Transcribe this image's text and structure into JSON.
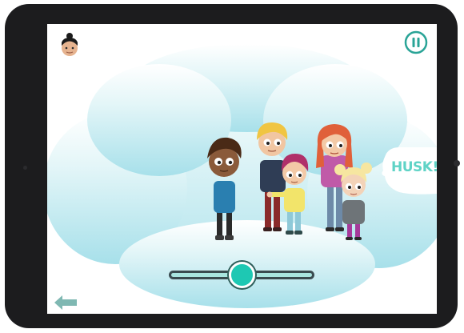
{
  "screen": {
    "husk_label": "HUSK!",
    "slider_value": 0.5
  },
  "icons": {
    "avatar": "narrator-avatar-icon",
    "pause": "pause-icon",
    "back": "back-arrow-icon"
  },
  "colors": {
    "accent": "#1ec8b3",
    "cloud": "#bfeaf0",
    "husk_text": "#5fd3c6",
    "back_arrow": "#7fb8b2"
  }
}
